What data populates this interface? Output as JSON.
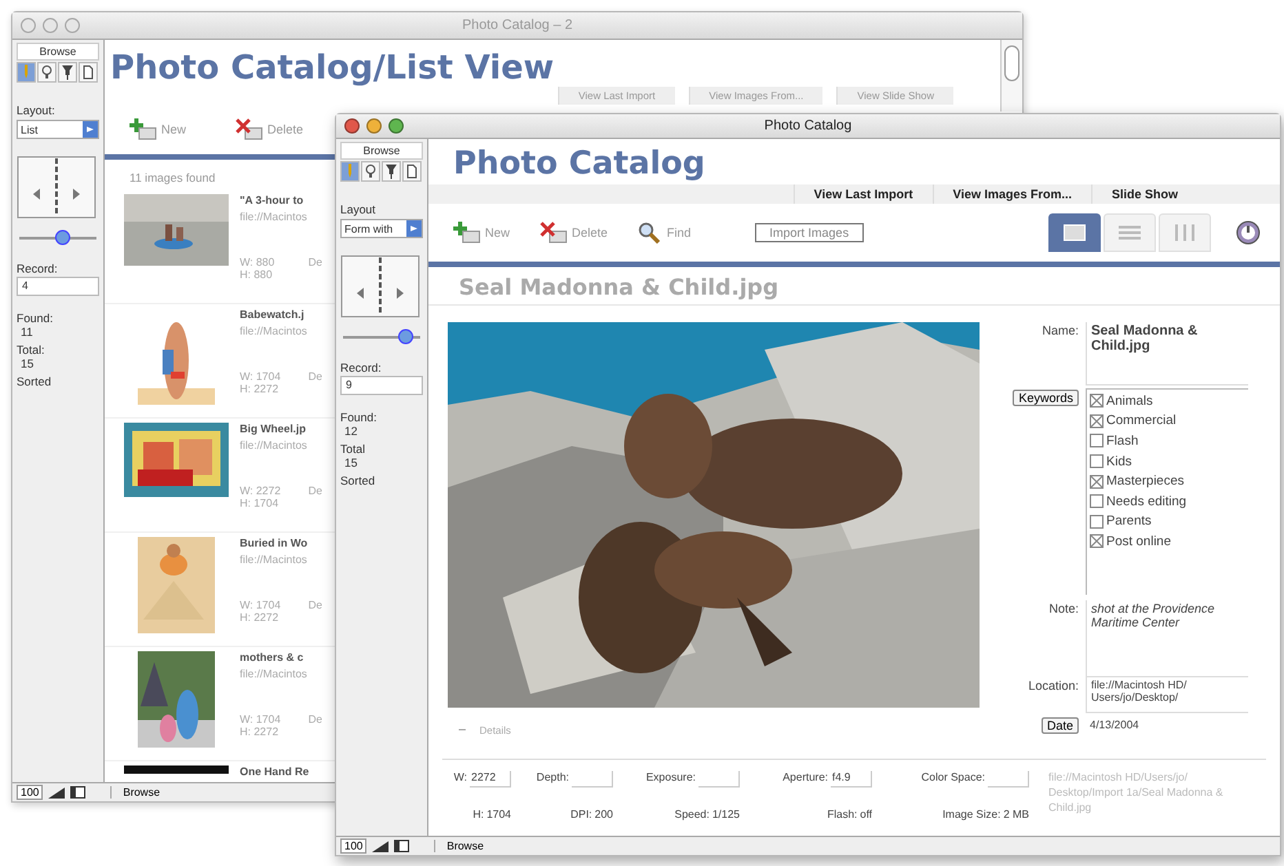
{
  "back_window": {
    "title": "Photo Catalog – 2",
    "active": false,
    "sidebar": {
      "mode": "Browse",
      "tools": [
        {
          "kind": "browse",
          "selected": true
        },
        {
          "kind": "find",
          "selected": false
        },
        {
          "kind": "layout",
          "selected": false
        },
        {
          "kind": "preview",
          "selected": false
        }
      ],
      "layout_label": "Layout:",
      "layout_value": "List",
      "slider": {
        "level": 0.55
      },
      "record_label": "Record:",
      "record_value": "4",
      "found_label": "Found:",
      "found_value": "11",
      "total_label": "Total:",
      "total_value": "15",
      "sorted": "Sorted"
    },
    "header": "Photo Catalog/List View",
    "nav": [
      "View Last Import",
      "View Images From...",
      "View Slide Show"
    ],
    "toolbar": [
      {
        "kind": "new",
        "label": "New"
      },
      {
        "kind": "delete",
        "label": "Delete"
      }
    ],
    "count": "11 images found",
    "rows": [
      {
        "title": "\"A 3-hour to",
        "path": "file://Macintos",
        "w": "W: 880",
        "h": "H: 880",
        "column_3": "De"
      },
      {
        "title": "Babewatch.j",
        "path": "file://Macintos",
        "w": "W: 1704",
        "h": "H: 2272",
        "column_3": "De"
      },
      {
        "title": "Big Wheel.jp",
        "path": "file://Macintos",
        "w": "W: 2272",
        "h": "H: 1704",
        "column_3": "De"
      },
      {
        "title": "Buried in Wo",
        "path": "file://Macintos",
        "w": "W: 1704",
        "h": "H: 2272",
        "column_3": "De"
      },
      {
        "title": "mothers & c",
        "path": "file://Macintos",
        "w": "W: 1704",
        "h": "H: 2272",
        "column_3": "De"
      },
      {
        "title": "One Hand Re"
      }
    ],
    "status": {
      "zoom": "100",
      "mode": "Browse"
    }
  },
  "front_window": {
    "title": "Photo Catalog",
    "active": true,
    "sidebar": {
      "mode": "Browse",
      "tools": [
        {
          "kind": "browse",
          "selected": true
        },
        {
          "kind": "find",
          "selected": false
        },
        {
          "kind": "layout",
          "selected": false
        },
        {
          "kind": "preview",
          "selected": false
        }
      ],
      "layout_label": "Layout",
      "layout_value": "Form with",
      "slider": {
        "level": 0.8
      },
      "record_label": "Record:",
      "record_value": "9",
      "found_label": "Found:",
      "found_value": "12",
      "total_label": "Total",
      "total_value": "15",
      "sorted": "Sorted"
    },
    "header": "Photo Catalog",
    "nav": [
      "View Last Import",
      "View Images From...",
      "Slide Show"
    ],
    "toolbar": [
      {
        "kind": "new",
        "label": "New"
      },
      {
        "kind": "delete",
        "label": "Delete"
      },
      {
        "kind": "find",
        "label": "Find"
      }
    ],
    "import_button": "Import Images",
    "views": [
      {
        "kind": "form",
        "selected": true
      },
      {
        "kind": "list",
        "selected": false
      },
      {
        "kind": "table",
        "selected": false
      }
    ],
    "record_title": "Seal Madonna & Child.jpg",
    "name_label": "Name:",
    "name_value": "Seal Madonna & Child.jpg",
    "keywords_button": "Keywords",
    "keywords": [
      {
        "label": "Animals",
        "checked": true
      },
      {
        "label": "Commercial",
        "checked": true
      },
      {
        "label": "Flash",
        "checked": false
      },
      {
        "label": "Kids",
        "checked": false
      },
      {
        "label": "Masterpieces",
        "checked": true
      },
      {
        "label": "Needs editing",
        "checked": false
      },
      {
        "label": "Parents",
        "checked": false
      },
      {
        "label": "Post online",
        "checked": true
      }
    ],
    "note_label": "Note:",
    "note_value": "shot at the Providence Maritime Center",
    "location_label": "Location:",
    "location_value": "file://Macintosh HD/ Users/jo/Desktop/",
    "date_button": "Date",
    "date_value": "4/13/2004",
    "details_toggle": "Details",
    "details": [
      [
        {
          "kind": "field",
          "label": "W:",
          "value": "2272"
        },
        {
          "kind": "field",
          "label": "Depth:"
        },
        {
          "kind": "field",
          "label": "Exposure:"
        },
        {
          "kind": "field",
          "label": "Aperture:",
          "value": "f4.9"
        },
        {
          "kind": "field",
          "label": "Color Space:"
        }
      ],
      [
        {
          "kind": "text",
          "label": "H:",
          "value": "1704"
        },
        {
          "kind": "text",
          "label": "DPI:",
          "value": "200"
        },
        {
          "kind": "text",
          "label": "Speed:",
          "value": "1/125"
        },
        {
          "kind": "text",
          "label": "Flash:",
          "value": "off"
        },
        {
          "kind": "text",
          "label": "Image Size:",
          "value": "2 MB"
        }
      ]
    ],
    "file_path": "file://Macintosh HD/Users/jo/ Desktop/Import 1a/Seal Madonna & Child.jpg",
    "status": {
      "zoom": "100",
      "mode": "Browse"
    }
  }
}
